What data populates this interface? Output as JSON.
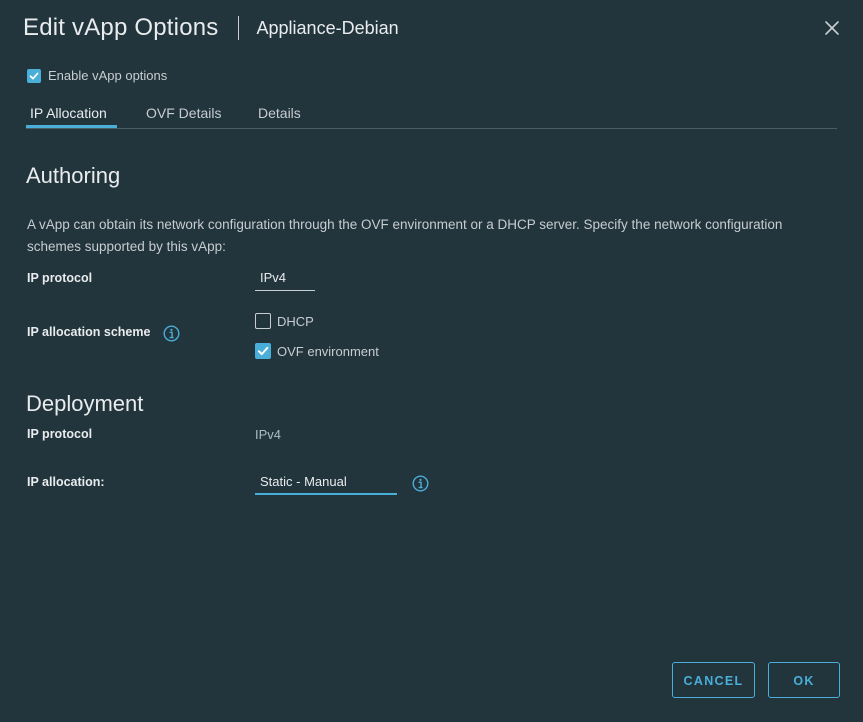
{
  "dialog": {
    "title": "Edit vApp Options",
    "subtitle": "Appliance-Debian"
  },
  "enable_vapp": {
    "label": "Enable vApp options",
    "checked": true
  },
  "tabs": [
    {
      "label": "IP Allocation",
      "active": true
    },
    {
      "label": "OVF Details",
      "active": false
    },
    {
      "label": "Details",
      "active": false
    }
  ],
  "authoring": {
    "title": "Authoring",
    "description": "A vApp can obtain its network configuration through the OVF environment or a DHCP server. Specify the network configuration schemes supported by this vApp:",
    "ip_protocol_label": "IP protocol",
    "ip_protocol_value": "IPv4",
    "scheme_label": "IP allocation scheme",
    "schemes": [
      {
        "label": "DHCP",
        "checked": false
      },
      {
        "label": "OVF environment",
        "checked": true
      }
    ]
  },
  "deployment": {
    "title": "Deployment",
    "ip_protocol_label": "IP protocol",
    "ip_protocol_value": "IPv4",
    "allocation_label": "IP allocation:",
    "allocation_value": "Static - Manual"
  },
  "buttons": {
    "cancel": "CANCEL",
    "ok": "OK"
  },
  "colors": {
    "background": "#22343c",
    "accent": "#49afd9",
    "text": "#c7cdd1",
    "heading": "#e9ecee"
  },
  "icons": {
    "close": "close-icon",
    "info": "info-icon",
    "check": "checkmark-icon"
  }
}
